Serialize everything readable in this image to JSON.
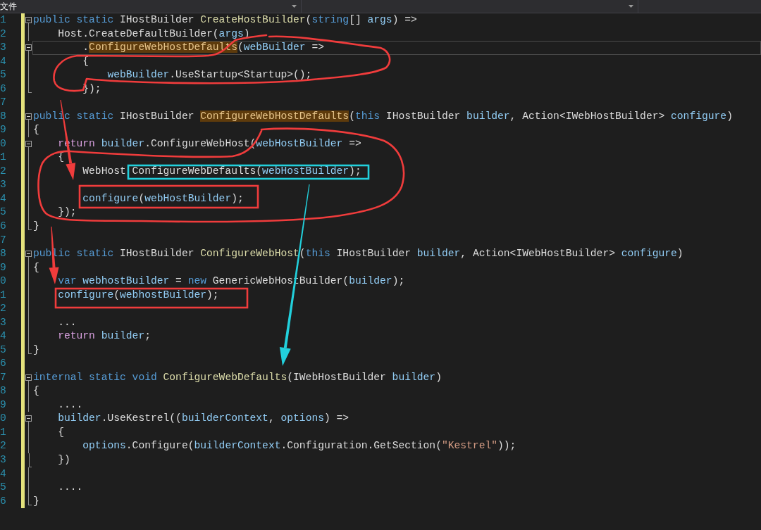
{
  "navigation_bar": {
    "project_dropdown": {
      "label": "文件"
    }
  },
  "editor": {
    "lines": [
      {
        "number": "1",
        "modified": true,
        "current": false,
        "fold": {
          "kind": "toggle",
          "expanded": true
        },
        "tokens": [
          {
            "kind": "keyword",
            "text": "public "
          },
          {
            "kind": "keyword",
            "text": "static"
          },
          {
            "kind": "plain",
            "text": " IHostBuilder "
          },
          {
            "kind": "method",
            "text": "CreateHostBuilder"
          },
          {
            "kind": "plain",
            "text": "("
          },
          {
            "kind": "keyword",
            "text": "string"
          },
          {
            "kind": "plain",
            "text": "[] "
          },
          {
            "kind": "parameter",
            "text": "args"
          },
          {
            "kind": "plain",
            "text": ") =>"
          }
        ]
      },
      {
        "number": "2",
        "modified": true,
        "current": false,
        "fold": {
          "kind": "guide"
        },
        "tokens": [
          {
            "kind": "plain",
            "text": "    Host.CreateDefaultBuilder("
          },
          {
            "kind": "parameter",
            "text": "args"
          },
          {
            "kind": "plain",
            "text": ")"
          }
        ]
      },
      {
        "number": "3",
        "modified": true,
        "current": true,
        "fold": {
          "kind": "toggle",
          "expanded": true
        },
        "tokens": [
          {
            "kind": "plain",
            "text": "        ."
          },
          {
            "kind": "reference",
            "text": "ConfigureWebHostDefaults"
          },
          {
            "kind": "plain",
            "text": "("
          },
          {
            "kind": "parameter",
            "text": "webBuilder"
          },
          {
            "kind": "plain",
            "text": " =>"
          }
        ]
      },
      {
        "number": "4",
        "modified": true,
        "current": false,
        "fold": {
          "kind": "guide"
        },
        "tokens": [
          {
            "kind": "plain",
            "text": "        {"
          }
        ]
      },
      {
        "number": "5",
        "modified": true,
        "current": false,
        "fold": {
          "kind": "guide"
        },
        "tokens": [
          {
            "kind": "parameter",
            "text": "            webBuilder"
          },
          {
            "kind": "plain",
            "text": ".UseStartup<Startup>();"
          }
        ]
      },
      {
        "number": "6",
        "modified": true,
        "current": false,
        "fold": {
          "kind": "end"
        },
        "tokens": [
          {
            "kind": "plain",
            "text": "        });"
          }
        ]
      },
      {
        "number": "7",
        "modified": true,
        "current": false
      },
      {
        "number": "8",
        "modified": true,
        "current": false,
        "fold": {
          "kind": "toggle",
          "expanded": true
        },
        "tokens": [
          {
            "kind": "keyword",
            "text": "public "
          },
          {
            "kind": "keyword",
            "text": "static"
          },
          {
            "kind": "plain",
            "text": " IHostBuilder "
          },
          {
            "kind": "reference",
            "text": "ConfigureWebHostDefaults"
          },
          {
            "kind": "plain",
            "text": "("
          },
          {
            "kind": "keyword",
            "text": "this"
          },
          {
            "kind": "plain",
            "text": " IHostBuilder "
          },
          {
            "kind": "parameter",
            "text": "builder"
          },
          {
            "kind": "plain",
            "text": ", Action<IWebHostBuilder> "
          },
          {
            "kind": "parameter",
            "text": "configure"
          },
          {
            "kind": "plain",
            "text": ")"
          }
        ]
      },
      {
        "number": "9",
        "modified": true,
        "current": false,
        "fold": {
          "kind": "guide"
        },
        "tokens": [
          {
            "kind": "plain",
            "text": "{"
          }
        ]
      },
      {
        "number": "0",
        "modified": true,
        "current": false,
        "fold": {
          "kind": "toggle",
          "expanded": true
        },
        "tokens": [
          {
            "kind": "control",
            "text": "    return "
          },
          {
            "kind": "parameter",
            "text": "builder"
          },
          {
            "kind": "plain",
            "text": ".ConfigureWebHost("
          },
          {
            "kind": "parameter",
            "text": "webHostBuilder"
          },
          {
            "kind": "plain",
            "text": " =>"
          }
        ]
      },
      {
        "number": "1",
        "modified": true,
        "current": false,
        "fold": {
          "kind": "guide"
        },
        "tokens": [
          {
            "kind": "plain",
            "text": "    {"
          }
        ]
      },
      {
        "number": "2",
        "modified": true,
        "current": false,
        "fold": {
          "kind": "guide"
        },
        "tokens": [
          {
            "kind": "plain",
            "text": "        WebHost ConfigureWebDefaults("
          },
          {
            "kind": "parameter",
            "text": "webHostBuilder"
          },
          {
            "kind": "plain",
            "text": ");"
          }
        ]
      },
      {
        "number": "3",
        "modified": true,
        "current": false,
        "fold": {
          "kind": "guide"
        }
      },
      {
        "number": "4",
        "modified": true,
        "current": false,
        "fold": {
          "kind": "guide"
        },
        "tokens": [
          {
            "kind": "parameter",
            "text": "        configure"
          },
          {
            "kind": "plain",
            "text": "("
          },
          {
            "kind": "parameter",
            "text": "webHostBuilder"
          },
          {
            "kind": "plain",
            "text": ");"
          }
        ]
      },
      {
        "number": "5",
        "modified": true,
        "current": false,
        "fold": {
          "kind": "guide"
        },
        "tokens": [
          {
            "kind": "plain",
            "text": "    });"
          }
        ]
      },
      {
        "number": "6",
        "modified": true,
        "current": false,
        "fold": {
          "kind": "end"
        },
        "tokens": [
          {
            "kind": "plain",
            "text": "}"
          }
        ]
      },
      {
        "number": "7",
        "modified": true,
        "current": false
      },
      {
        "number": "8",
        "modified": true,
        "current": false,
        "fold": {
          "kind": "toggle",
          "expanded": true
        },
        "tokens": [
          {
            "kind": "keyword",
            "text": "public "
          },
          {
            "kind": "keyword",
            "text": "static"
          },
          {
            "kind": "plain",
            "text": " IHostBuilder "
          },
          {
            "kind": "method",
            "text": "ConfigureWebHost"
          },
          {
            "kind": "plain",
            "text": "("
          },
          {
            "kind": "keyword",
            "text": "this"
          },
          {
            "kind": "plain",
            "text": " IHostBuilder "
          },
          {
            "kind": "parameter",
            "text": "builder"
          },
          {
            "kind": "plain",
            "text": ", Action<IWebHostBuilder> "
          },
          {
            "kind": "parameter",
            "text": "configure"
          },
          {
            "kind": "plain",
            "text": ")"
          }
        ]
      },
      {
        "number": "9",
        "modified": true,
        "current": false,
        "fold": {
          "kind": "guide"
        },
        "tokens": [
          {
            "kind": "plain",
            "text": "{"
          }
        ]
      },
      {
        "number": "0",
        "modified": true,
        "current": false,
        "fold": {
          "kind": "guide"
        },
        "tokens": [
          {
            "kind": "keyword",
            "text": "    var "
          },
          {
            "kind": "parameter",
            "text": "webhostBuilder"
          },
          {
            "kind": "plain",
            "text": " = "
          },
          {
            "kind": "keyword",
            "text": "new"
          },
          {
            "kind": "plain",
            "text": " GenericWebHostBuilder("
          },
          {
            "kind": "parameter",
            "text": "builder"
          },
          {
            "kind": "plain",
            "text": ");"
          }
        ]
      },
      {
        "number": "1",
        "modified": true,
        "current": false,
        "fold": {
          "kind": "guide"
        },
        "tokens": [
          {
            "kind": "parameter",
            "text": "    configure"
          },
          {
            "kind": "plain",
            "text": "("
          },
          {
            "kind": "parameter",
            "text": "webhostBuilder"
          },
          {
            "kind": "plain",
            "text": ");"
          }
        ]
      },
      {
        "number": "2",
        "modified": true,
        "current": false,
        "fold": {
          "kind": "guide"
        }
      },
      {
        "number": "3",
        "modified": true,
        "current": false,
        "fold": {
          "kind": "guide"
        },
        "tokens": [
          {
            "kind": "plain",
            "text": "    ..."
          }
        ]
      },
      {
        "number": "4",
        "modified": true,
        "current": false,
        "fold": {
          "kind": "guide"
        },
        "tokens": [
          {
            "kind": "control",
            "text": "    return "
          },
          {
            "kind": "parameter",
            "text": "builder"
          },
          {
            "kind": "plain",
            "text": ";"
          }
        ]
      },
      {
        "number": "5",
        "modified": true,
        "current": false,
        "fold": {
          "kind": "end"
        },
        "tokens": [
          {
            "kind": "plain",
            "text": "}"
          }
        ]
      },
      {
        "number": "6",
        "modified": true,
        "current": false
      },
      {
        "number": "7",
        "modified": true,
        "current": false,
        "fold": {
          "kind": "toggle",
          "expanded": true
        },
        "tokens": [
          {
            "kind": "keyword",
            "text": "internal "
          },
          {
            "kind": "keyword",
            "text": "static "
          },
          {
            "kind": "keyword",
            "text": "void "
          },
          {
            "kind": "method",
            "text": "ConfigureWebDefaults"
          },
          {
            "kind": "plain",
            "text": "(IWebHostBuilder "
          },
          {
            "kind": "parameter",
            "text": "builder"
          },
          {
            "kind": "plain",
            "text": ")"
          }
        ]
      },
      {
        "number": "8",
        "modified": true,
        "current": false,
        "fold": {
          "kind": "guide"
        },
        "tokens": [
          {
            "kind": "plain",
            "text": "{"
          }
        ]
      },
      {
        "number": "9",
        "modified": true,
        "current": false,
        "fold": {
          "kind": "guide"
        },
        "tokens": [
          {
            "kind": "plain",
            "text": "    ...."
          }
        ]
      },
      {
        "number": "0",
        "modified": true,
        "current": false,
        "fold": {
          "kind": "toggle",
          "expanded": true
        },
        "tokens": [
          {
            "kind": "parameter",
            "text": "    builder"
          },
          {
            "kind": "plain",
            "text": ".UseKestrel(("
          },
          {
            "kind": "parameter",
            "text": "builderContext"
          },
          {
            "kind": "plain",
            "text": ", "
          },
          {
            "kind": "parameter",
            "text": "options"
          },
          {
            "kind": "plain",
            "text": ") =>"
          }
        ]
      },
      {
        "number": "1",
        "modified": true,
        "current": false,
        "fold": {
          "kind": "guide"
        },
        "tokens": [
          {
            "kind": "plain",
            "text": "    {"
          }
        ]
      },
      {
        "number": "2",
        "modified": true,
        "current": false,
        "fold": {
          "kind": "guide"
        },
        "tokens": [
          {
            "kind": "parameter",
            "text": "        options"
          },
          {
            "kind": "plain",
            "text": ".Configure("
          },
          {
            "kind": "parameter",
            "text": "builderContext"
          },
          {
            "kind": "plain",
            "text": ".Configuration.GetSection("
          },
          {
            "kind": "string",
            "text": "\"Kestrel\""
          },
          {
            "kind": "plain",
            "text": "));"
          }
        ]
      },
      {
        "number": "3",
        "modified": true,
        "current": false,
        "fold": {
          "kind": "inner_end"
        },
        "tokens": [
          {
            "kind": "plain",
            "text": "    })"
          }
        ]
      },
      {
        "number": "4",
        "modified": true,
        "current": false,
        "fold": {
          "kind": "guide"
        }
      },
      {
        "number": "5",
        "modified": true,
        "current": false,
        "fold": {
          "kind": "guide"
        },
        "tokens": [
          {
            "kind": "plain",
            "text": "    ...."
          }
        ]
      },
      {
        "number": "6",
        "modified": true,
        "current": false,
        "fold": {
          "kind": "end"
        },
        "tokens": [
          {
            "kind": "plain",
            "text": "}"
          }
        ]
      }
    ]
  },
  "annotations": [
    {
      "kind": "loop",
      "color": "#f03c3c"
    },
    {
      "kind": "arrow",
      "color": "#f03c3c"
    },
    {
      "kind": "loop",
      "color": "#f03c3c"
    },
    {
      "kind": "box",
      "color": "#22d0dc"
    },
    {
      "kind": "box",
      "color": "#f03c3c"
    },
    {
      "kind": "arrow",
      "color": "#22d0dc"
    },
    {
      "kind": "arrow",
      "color": "#f03c3c"
    },
    {
      "kind": "box",
      "color": "#f03c3c"
    }
  ]
}
